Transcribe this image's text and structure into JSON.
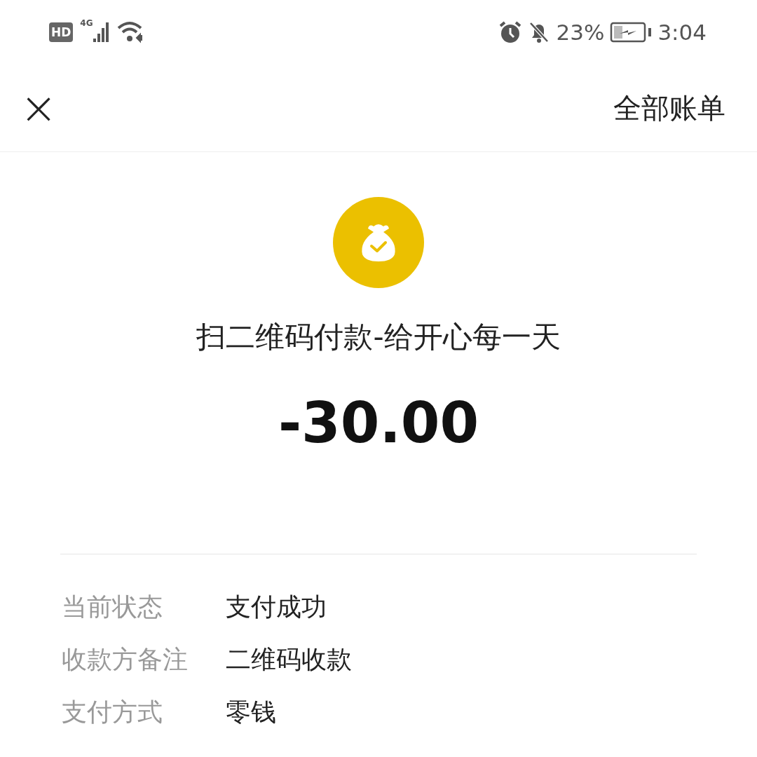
{
  "status_bar": {
    "hd": "HD",
    "network": "4G",
    "battery": "23%",
    "time": "3:04"
  },
  "header": {
    "close": "×",
    "action": "全部账单"
  },
  "transaction": {
    "title": "扫二维码付款-给开心每一天",
    "amount": "-30.00"
  },
  "details": [
    {
      "label": "当前状态",
      "value": "支付成功"
    },
    {
      "label": "收款方备注",
      "value": "二维码收款"
    },
    {
      "label": "支付方式",
      "value": "零钱"
    }
  ]
}
